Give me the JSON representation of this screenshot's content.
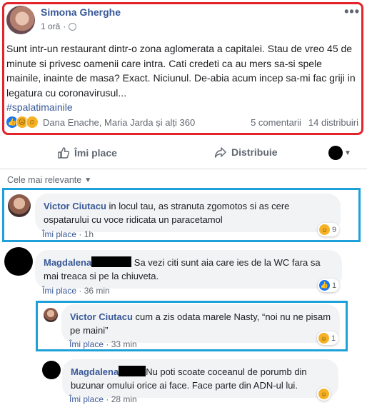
{
  "post": {
    "author": "Simona Gherghe",
    "time": "1 oră",
    "text": "Sunt intr-un restaurant dintr-o zona aglomerata a capitalei. Stau de vreo 45 de minute si privesc oamenii care intra. Cati credeti ca au mers sa-si spele mainile, inainte de masa? Exact. Niciunul. De-abia acum incep sa-mi fac griji in legatura cu coronavirusul...",
    "hashtag": "#spalatimainile",
    "reactors": "Dana Enache, Maria Jarda și alți 360",
    "comments_count": "5 comentarii",
    "shares_count": "14 distribuiri"
  },
  "actions": {
    "like": "Îmi place",
    "share": "Distribuie"
  },
  "sort": {
    "label": "Cele mai relevante"
  },
  "comments": [
    {
      "author": "Victor Ciutacu",
      "text": " in locul tau, as stranuta zgomotos si as cere ospatarului cu voce ridicata un paracetamol",
      "like": "Îmi place",
      "time": "1h",
      "reactions": "9"
    },
    {
      "author": "Magdalena",
      "text": " Sa vezi citi sunt aia care ies de la WC fara sa mai treaca si pe la chiuveta.",
      "like": "Îmi place",
      "time": "36 min",
      "reactions": "1"
    },
    {
      "author": "Victor Ciutacu",
      "text": " cum a zis odata marele Nasty, “noi nu ne pisam pe maini”",
      "like": "Îmi place",
      "time": "33 min",
      "reactions": "1"
    },
    {
      "author": "Magdalena",
      "text": "Nu poti scoate coceanul de porumb din buzunar omului orice ai face. Face parte din ADN-ul lui.",
      "like": "Îmi place",
      "time": "28 min",
      "reactions": ""
    }
  ],
  "separator": " · ",
  "colors": {
    "post_highlight": "#e4242b",
    "comment_highlight": "#1ea0d8",
    "link": "#385898"
  }
}
